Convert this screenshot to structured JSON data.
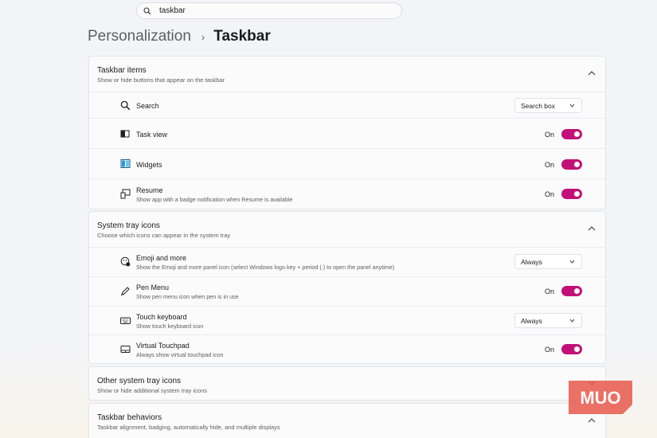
{
  "search": {
    "value": "taskbar"
  },
  "breadcrumb": {
    "parent": "Personalization",
    "separator": "›",
    "current": "Taskbar"
  },
  "accent_color": "#c30f78",
  "taskbar_items": {
    "title": "Taskbar items",
    "subtitle": "Show or hide buttons that appear on the taskbar",
    "expanded": true,
    "rows": [
      {
        "label": "Search",
        "icon": "search-icon",
        "control": "dropdown",
        "value": "Search box"
      },
      {
        "label": "Task view",
        "icon": "task-view-icon",
        "control": "toggle",
        "state": "On"
      },
      {
        "label": "Widgets",
        "icon": "widgets-icon",
        "control": "toggle",
        "state": "On"
      },
      {
        "label": "Resume",
        "subtitle": "Show app with a badge notification when Resume is available",
        "icon": "resume-icon",
        "control": "toggle",
        "state": "On"
      }
    ]
  },
  "system_tray_icons": {
    "title": "System tray icons",
    "subtitle": "Choose which icons can appear in the system tray",
    "expanded": true,
    "rows": [
      {
        "label": "Emoji and more",
        "subtitle": "Show the Emoji and more panel icon (select Windows logo key + period (.) to open the panel anytime)",
        "icon": "emoji-icon",
        "control": "dropdown",
        "value": "Always"
      },
      {
        "label": "Pen Menu",
        "subtitle": "Show pen menu icon when pen is in use",
        "icon": "pen-icon",
        "control": "toggle",
        "state": "On"
      },
      {
        "label": "Touch keyboard",
        "subtitle": "Show touch keyboard icon",
        "icon": "keyboard-icon",
        "control": "dropdown",
        "value": "Always"
      },
      {
        "label": "Virtual Touchpad",
        "subtitle": "Always show virtual touchpad icon",
        "icon": "touchpad-icon",
        "control": "toggle",
        "state": "On"
      }
    ]
  },
  "other_tray_icons": {
    "title": "Other system tray icons",
    "subtitle": "Show or hide additional system tray icons",
    "expanded": false
  },
  "taskbar_behaviors": {
    "title": "Taskbar behaviors",
    "subtitle": "Taskbar alignment, badging, automatically hide, and multiple displays",
    "expanded": false
  },
  "watermark": {
    "text": "MUO",
    "color": "#e8574b"
  }
}
